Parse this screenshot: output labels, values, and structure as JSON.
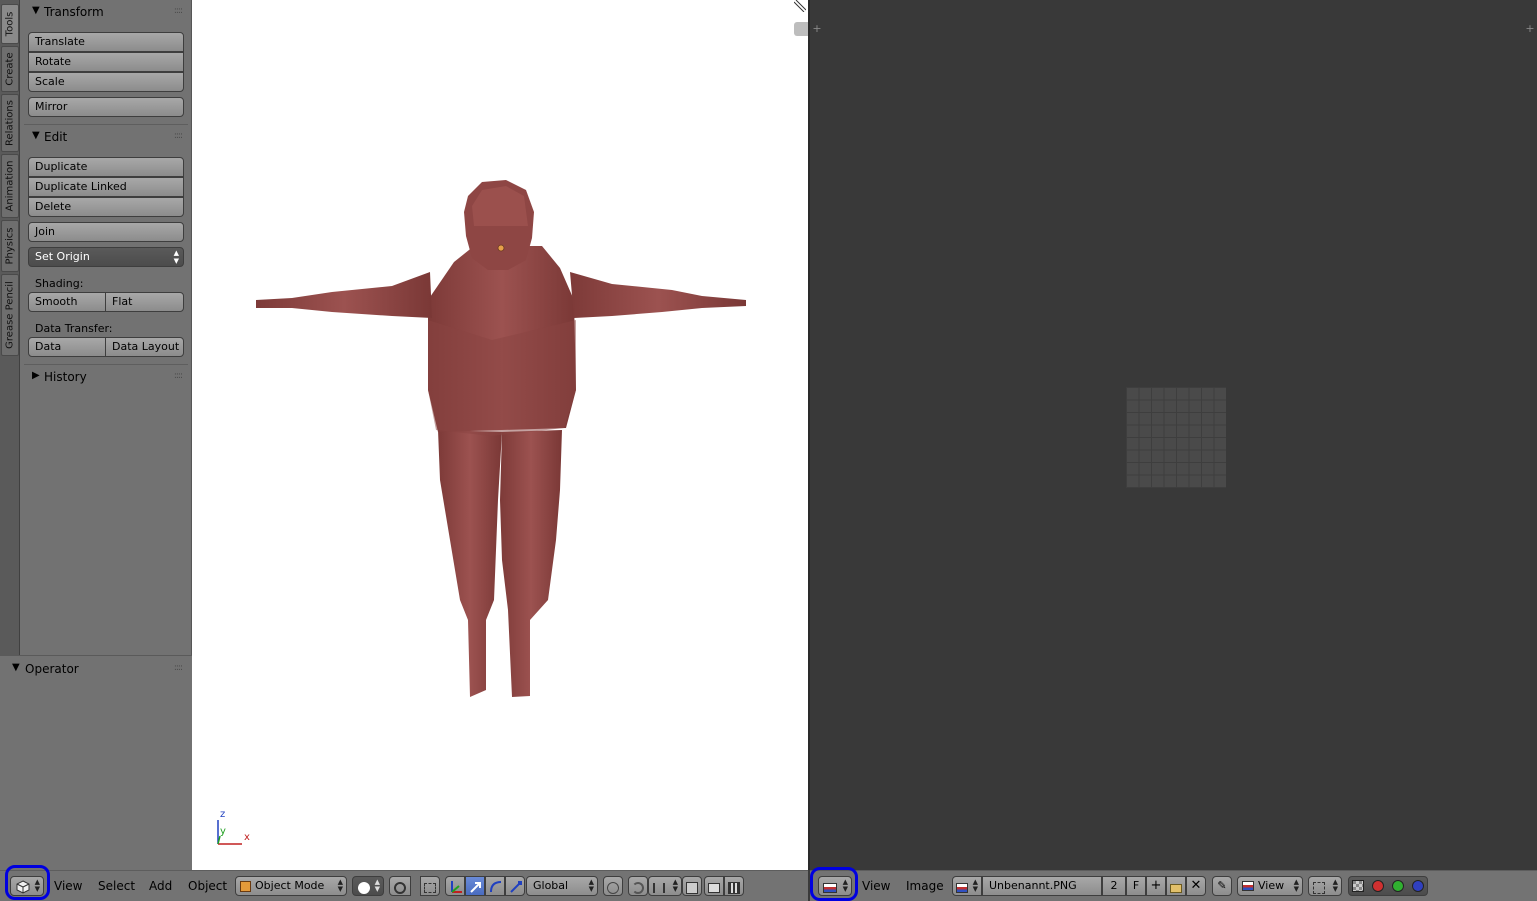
{
  "tabs": [
    "Tools",
    "Create",
    "Relations",
    "Animation",
    "Physics",
    "Grease Pencil"
  ],
  "transform": {
    "title": "Transform",
    "translate": "Translate",
    "rotate": "Rotate",
    "scale": "Scale",
    "mirror": "Mirror"
  },
  "edit": {
    "title": "Edit",
    "duplicate": "Duplicate",
    "duplicate_linked": "Duplicate Linked",
    "delete": "Delete",
    "join": "Join",
    "set_origin": "Set Origin",
    "shading_label": "Shading:",
    "smooth": "Smooth",
    "flat": "Flat",
    "data_transfer_label": "Data Transfer:",
    "data": "Data",
    "data_layout": "Data Layout"
  },
  "history": {
    "title": "History"
  },
  "operator": {
    "title": "Operator"
  },
  "axes": {
    "z": "z",
    "y": "y",
    "x": "x"
  },
  "header3d": {
    "view": "View",
    "select": "Select",
    "add": "Add",
    "object": "Object",
    "mode": "Object Mode",
    "orientation": "Global"
  },
  "headerimg": {
    "view": "View",
    "image": "Image",
    "image_name": "Unbenannt.PNG",
    "users": "2",
    "fake_user": "F",
    "view_mode": "View"
  },
  "colors": {
    "model": "#8e4644",
    "highlight": "#0000e0",
    "viewport_bg": "#ffffff",
    "image_editor_bg": "#393939"
  }
}
